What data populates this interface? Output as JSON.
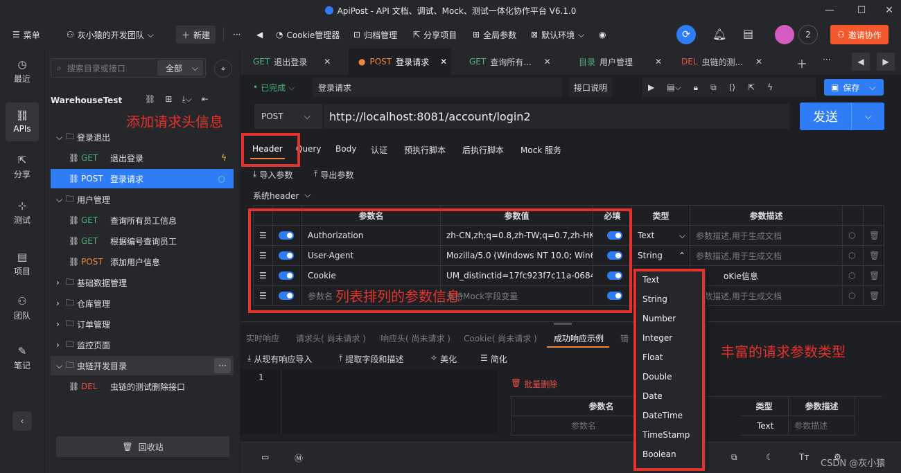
{
  "window": {
    "title": "ApiPost - API 文档、调试、Mock、测试一体化协作平台 V6.1.0"
  },
  "topbar": {
    "menu_label": "菜单",
    "team_name": "灰小猿的开发团队",
    "new_label": "新建",
    "cookie_label": "Cookie管理器",
    "archive_label": "归档管理",
    "share_label": "分享项目",
    "global_params_label": "全局参数",
    "env_label": "默认环境",
    "user_count": "2",
    "invite_label": "邀请协作"
  },
  "leftnav": {
    "items": [
      "最近",
      "APIs",
      "分享",
      "测试",
      "项目",
      "团队",
      "笔记"
    ]
  },
  "tree": {
    "search_placeholder": "搜索目录或接口",
    "filter_value": "全部",
    "project_name": "WarehouseTest",
    "recycle_label": "回收站",
    "rows": [
      {
        "type": "folder",
        "label": "登录退出"
      },
      {
        "type": "api",
        "method": "GET",
        "label": "退出登录"
      },
      {
        "type": "api",
        "method": "POST",
        "label": "登录请求"
      },
      {
        "type": "folder",
        "label": "用户管理"
      },
      {
        "type": "api",
        "method": "GET",
        "label": "查询所有员工信息"
      },
      {
        "type": "api",
        "method": "GET",
        "label": "根据编号查询员工"
      },
      {
        "type": "api",
        "method": "POST",
        "label": "添加用户信息"
      },
      {
        "type": "folder-closed",
        "label": "基础数据管理"
      },
      {
        "type": "folder-closed",
        "label": "仓库管理"
      },
      {
        "type": "folder-closed",
        "label": "订单管理"
      },
      {
        "type": "folder-closed",
        "label": "监控页面"
      },
      {
        "type": "folder",
        "label": "虫链开发目录"
      },
      {
        "type": "api",
        "method": "DEL",
        "label": "虫链的测试删除接口"
      }
    ]
  },
  "tabs": [
    {
      "method": "GET",
      "label": "退出登录"
    },
    {
      "method": "POST",
      "label": "登录请求"
    },
    {
      "method": "GET",
      "label": "查询所有..."
    },
    {
      "method": "目录",
      "label": "用户管理"
    },
    {
      "method": "DEL",
      "label": "虫链的测..."
    }
  ],
  "request": {
    "status": "已完成",
    "name": "登录请求",
    "doc_label": "接口说明",
    "save_label": "保存",
    "method": "POST",
    "url": "http://localhost:8081/account/login2",
    "send_label": "发送"
  },
  "subtabs": [
    "Header",
    "Query",
    "Body",
    "认证",
    "预执行脚本",
    "后执行脚本",
    "Mock 服务"
  ],
  "param_tools": {
    "import": "导入参数",
    "export": "导出参数",
    "system_header": "系统header"
  },
  "param_table": {
    "headers": [
      "参数名",
      "参数值",
      "必填",
      "类型",
      "参数描述"
    ],
    "rows": [
      {
        "name": "Authorization",
        "value": "zh-CN,zh;q=0.8,zh-TW;q=0.7,zh-HK;",
        "type": "Text",
        "desc": "参数描述,用于生成文档"
      },
      {
        "name": "User-Agent",
        "value": "Mozilla/5.0 (Windows NT 10.0; Win6",
        "type": "String",
        "desc": "参数描述,用于生成文档"
      },
      {
        "name": "Cookie",
        "value": "UM_distinctid=17fc923f7c11a-0684",
        "type": "",
        "desc": "oKie信息"
      },
      {
        "name": "参数名",
        "value": "支持Mock字段变量",
        "type": "",
        "desc": "参数描述,用于生成文档"
      }
    ]
  },
  "type_dropdown": [
    "Text",
    "String",
    "Number",
    "Integer",
    "Float",
    "Double",
    "Date",
    "DateTime",
    "TimeStamp",
    "Boolean"
  ],
  "response": {
    "tabs": [
      "实时响应",
      "请求头( 尚未请求 )",
      "响应头( 尚未请求 )",
      "Cookie( 尚未请求 )",
      "成功响应示例",
      "错"
    ],
    "tools": [
      "从现有响应导入",
      "提取字段和描述",
      "美化",
      "简化"
    ],
    "line_no": "1",
    "bulk_delete": "批量删除",
    "table_headers": [
      "参数名",
      "类型",
      "参数描述"
    ],
    "row": {
      "name": "参数名",
      "type": "Text",
      "desc": "参数描述"
    }
  },
  "annotations": {
    "header": "添加请求头信息",
    "list": "列表排列的参数信息",
    "types": "丰富的请求参数类型"
  },
  "watermark": "CSDN @灰小猿",
  "colors": {
    "accent": "#2e7cf6",
    "annotation": "#e5322d",
    "get": "#4caf7a",
    "post": "#f0883e",
    "del": "#e8534a",
    "invite": "#f5582c"
  }
}
